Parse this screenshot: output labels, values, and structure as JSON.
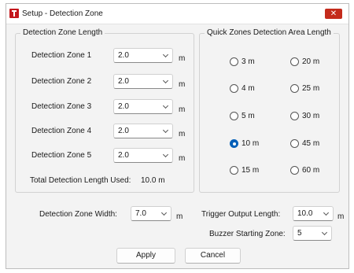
{
  "window": {
    "title": "Setup - Detection Zone",
    "close_glyph": "✕"
  },
  "length_group": {
    "title": "Detection Zone Length",
    "zones": [
      {
        "label": "Detection Zone 1",
        "value": "2.0",
        "unit": "m"
      },
      {
        "label": "Detection Zone 2",
        "value": "2.0",
        "unit": "m"
      },
      {
        "label": "Detection Zone 3",
        "value": "2.0",
        "unit": "m"
      },
      {
        "label": "Detection Zone 4",
        "value": "2.0",
        "unit": "m"
      },
      {
        "label": "Detection Zone 5",
        "value": "2.0",
        "unit": "m"
      }
    ],
    "total_label": "Total Detection Length Used:",
    "total_value": "10.0 m"
  },
  "quick_group": {
    "title": "Quick Zones Detection Area Length",
    "options": [
      "3 m",
      "4 m",
      "5 m",
      "10 m",
      "15 m",
      "20 m",
      "25 m",
      "30 m",
      "45 m",
      "60 m"
    ],
    "selected": "10 m"
  },
  "width": {
    "label": "Detection Zone Width:",
    "value": "7.0",
    "unit": "m"
  },
  "trigger": {
    "label": "Trigger Output Length:",
    "value": "10.0",
    "unit": "m"
  },
  "buzzer": {
    "label": "Buzzer Starting Zone:",
    "value": "5"
  },
  "buttons": {
    "apply": "Apply",
    "cancel": "Cancel"
  },
  "colors": {
    "accent": "#005fb8",
    "close": "#c42b1c",
    "app_icon": "#c4161c"
  }
}
